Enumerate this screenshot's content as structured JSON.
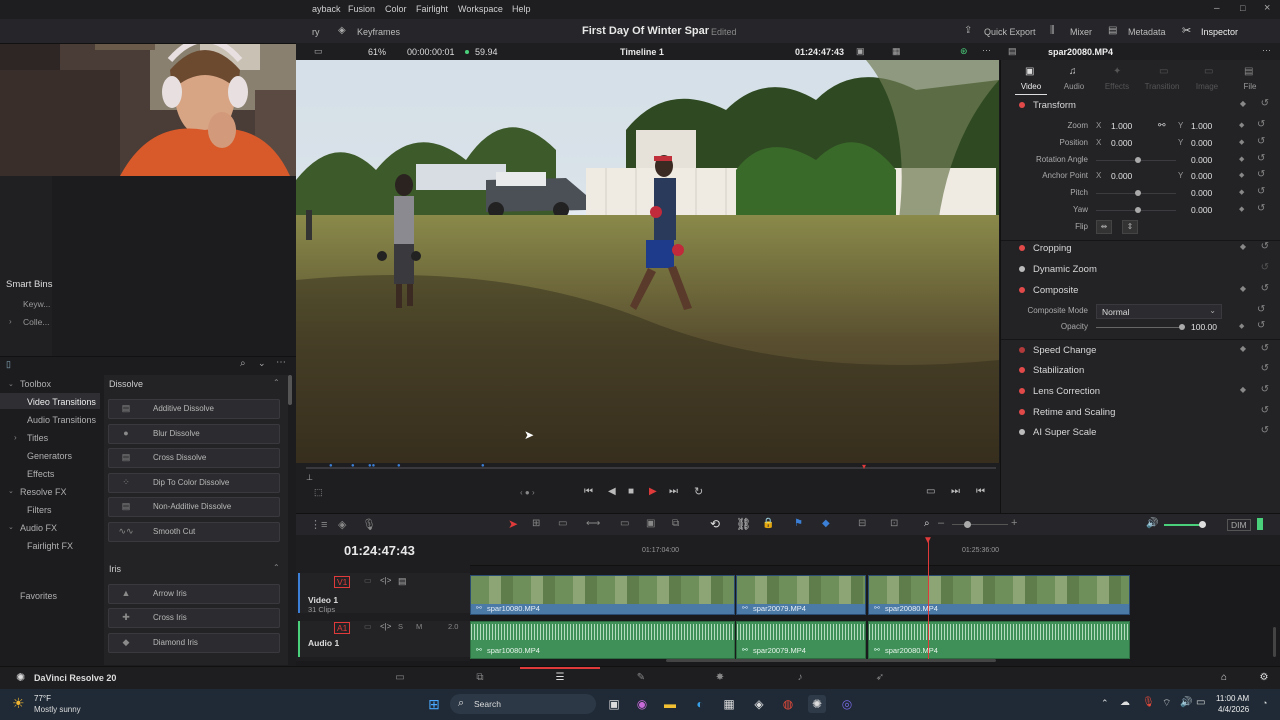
{
  "menu": {
    "items": [
      "ayback",
      "Fusion",
      "Color",
      "Fairlight",
      "Workspace",
      "Help"
    ]
  },
  "toolbar": {
    "left_label": "ry",
    "keyframes": "Keyframes",
    "project_title": "First Day Of Winter Spar",
    "project_status": "Edited",
    "quick_export": "Quick Export",
    "mixer": "Mixer",
    "metadata": "Metadata",
    "inspector": "Inspector"
  },
  "viewer": {
    "zoom": "61%",
    "timecode_left": "00:00:00:01",
    "fps": "59.94",
    "timeline_name": "Timeline 1",
    "timecode_right": "01:24:47:43",
    "clip_name": "spar20080.MP4"
  },
  "inspector": {
    "tabs": [
      "Video",
      "Audio",
      "Effects",
      "Transition",
      "Image",
      "File"
    ],
    "transform": {
      "title": "Transform",
      "zoom_label": "Zoom",
      "zoom_x": "1.000",
      "zoom_y": "1.000",
      "position_label": "Position",
      "position_x": "0.000",
      "position_y": "0.000",
      "rotation_label": "Rotation Angle",
      "rotation": "0.000",
      "anchor_label": "Anchor Point",
      "anchor_x": "0.000",
      "anchor_y": "0.000",
      "pitch_label": "Pitch",
      "pitch": "0.000",
      "yaw_label": "Yaw",
      "yaw": "0.000",
      "flip_label": "Flip",
      "axis_x": "X",
      "axis_y": "Y"
    },
    "cropping": "Cropping",
    "dynamic_zoom": "Dynamic Zoom",
    "composite": {
      "title": "Composite",
      "mode_label": "Composite Mode",
      "mode_value": "Normal",
      "opacity_label": "Opacity",
      "opacity": "100.00"
    },
    "sections": [
      "Speed Change",
      "Stabilization",
      "Lens Correction",
      "Retime and Scaling",
      "AI Super Scale"
    ]
  },
  "left": {
    "smart_bins": "Smart Bins",
    "smart_items": [
      "Keyw...",
      "Colle..."
    ],
    "toolbox": [
      "Toolbox",
      "Video Transitions",
      "Audio Transitions",
      "Titles",
      "Generators",
      "Effects",
      "Resolve FX",
      "Filters",
      "Audio FX",
      "Fairlight FX"
    ],
    "favorites": "Favorites",
    "dissolve_header": "Dissolve",
    "dissolve_items": [
      "Additive Dissolve",
      "Blur Dissolve",
      "Cross Dissolve",
      "Dip To Color Dissolve",
      "Non-Additive Dissolve",
      "Smooth Cut"
    ],
    "iris_header": "Iris",
    "iris_items": [
      "Arrow Iris",
      "Cross Iris",
      "Diamond Iris"
    ]
  },
  "timeline": {
    "timecode": "01:24:47:43",
    "ruler": [
      "01:17:04:00",
      "01:25:36:00"
    ],
    "video_track": {
      "id": "V1",
      "name": "Video 1",
      "count": "31 Clips"
    },
    "audio_track": {
      "id": "A1",
      "name": "Audio 1",
      "channels": "2.0",
      "s": "S",
      "m": "M"
    },
    "clips": [
      "spar10080.MP4",
      "spar20079.MP4",
      "spar20080.MP4"
    ],
    "dim": "DIM"
  },
  "app": {
    "name": "DaVinci Resolve 20"
  },
  "taskbar": {
    "weather_temp": "77°F",
    "weather_desc": "Mostly sunny",
    "search": "Search",
    "time": "11:00 AM",
    "date": "4/4/2026"
  },
  "colors": {
    "accent_red": "#e24a4a",
    "video_clip": "#4c7aa6",
    "audio_clip": "#3f8f58",
    "playhead": "#e03a3a"
  }
}
